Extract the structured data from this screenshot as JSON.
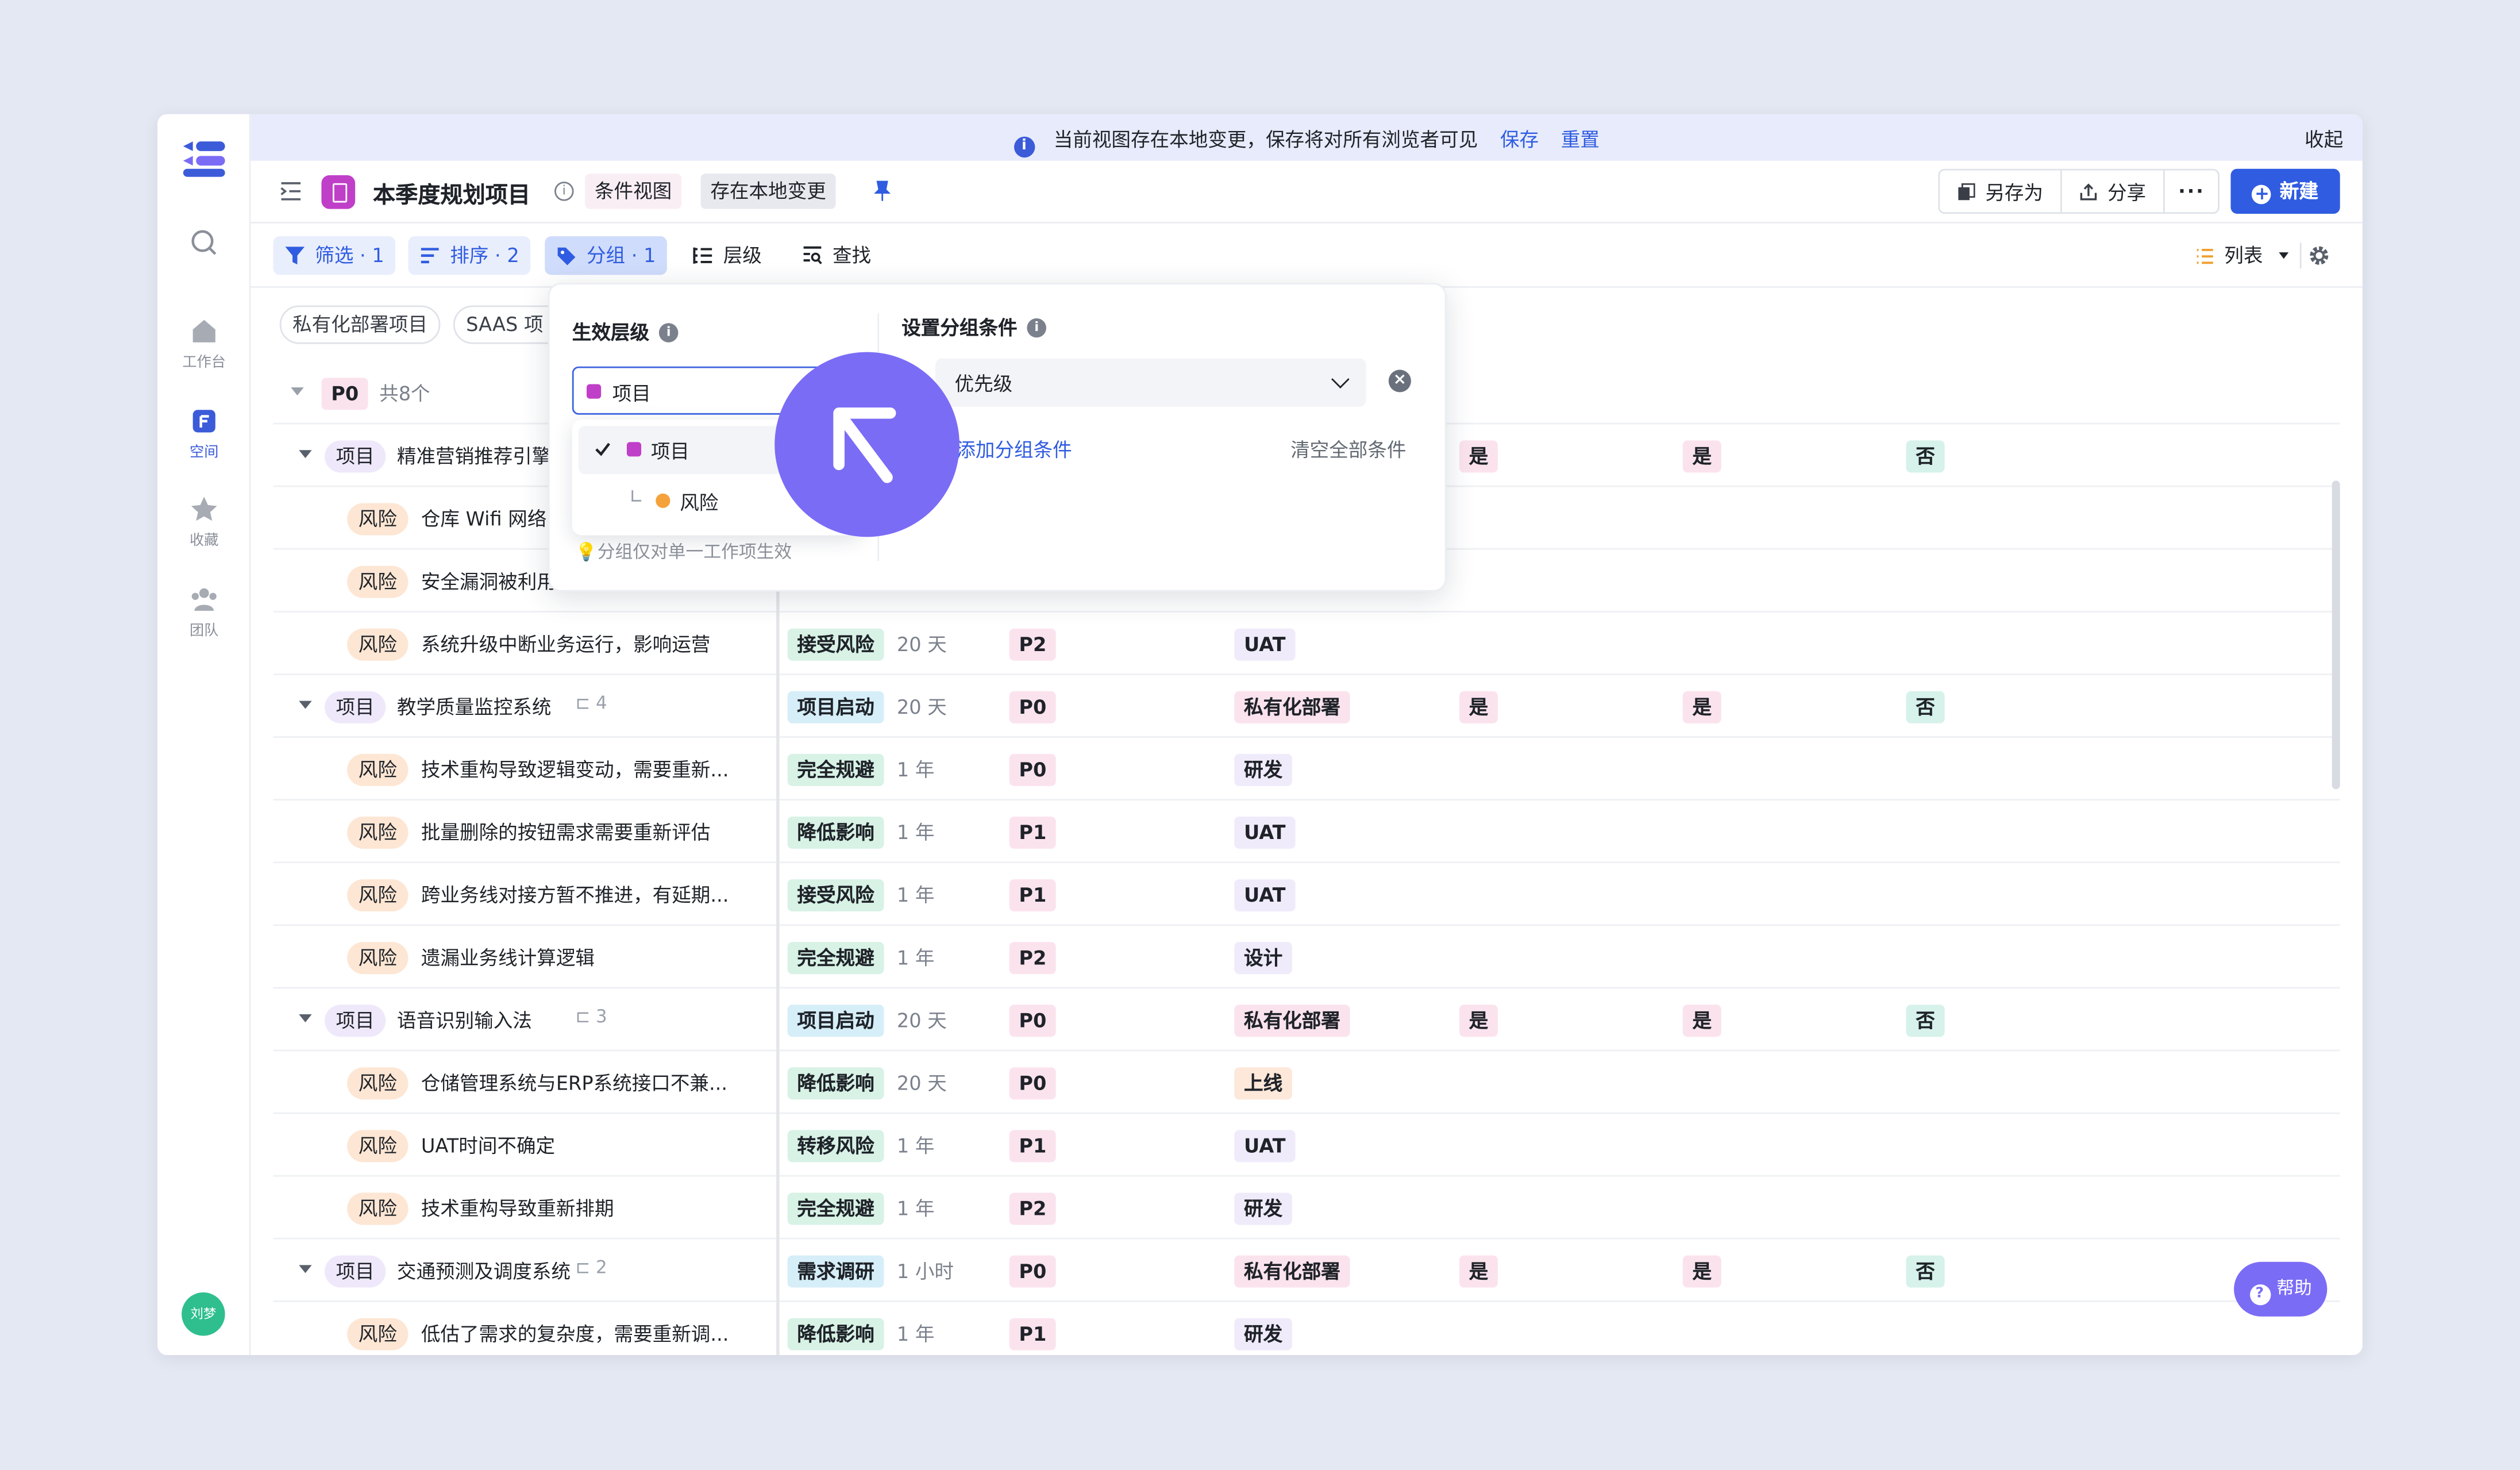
{
  "rail": {
    "items": [
      {
        "label": ""
      },
      {
        "label": "工作台"
      },
      {
        "label": "空间"
      },
      {
        "label": "收藏"
      },
      {
        "label": "团队"
      }
    ],
    "avatar": "刘梦"
  },
  "banner": {
    "message": "当前视图存在本地变更，保存将对所有浏览者可见",
    "save": "保存",
    "reset": "重置",
    "collapse": "收起"
  },
  "header": {
    "title": "本季度规划项目",
    "view_chip": "条件视图",
    "local_chip": "存在本地变更",
    "save_as": "另存为",
    "share": "分享",
    "more": "···",
    "new": "新建"
  },
  "toolbar": {
    "filter": "筛选 · 1",
    "sort": "排序 · 2",
    "group": "分组 · 1",
    "level": "层级",
    "find": "查找",
    "view_mode": "列表"
  },
  "pills": [
    "私有化部署项目",
    "SAAS 项"
  ],
  "group_header": {
    "label": "P0",
    "count": "共8个"
  },
  "rows": [
    {
      "kind": "proj",
      "type": "项目",
      "title": "精准营销推荐引擎",
      "yes1": "是",
      "yes2": "是",
      "no": "否"
    },
    {
      "kind": "risk",
      "type": "风险",
      "title": "仓库 Wifi 网络..."
    },
    {
      "kind": "risk",
      "type": "风险",
      "title": "安全漏洞被利用，..."
    },
    {
      "kind": "risk",
      "type": "风险",
      "title": "系统升级中断业务运行，影响运营",
      "strategy": "接受风险",
      "duration": "20 天",
      "priority": "P2",
      "stage": "UAT"
    },
    {
      "kind": "proj",
      "type": "项目",
      "title": "教学质量监控系统",
      "children": "4",
      "strategy": "项目启动",
      "duration": "20 天",
      "priority": "P0",
      "stage": "私有化部署",
      "yes1": "是",
      "yes2": "是",
      "no": "否"
    },
    {
      "kind": "risk",
      "type": "风险",
      "title": "技术重构导致逻辑变动，需要重新...",
      "strategy": "完全规避",
      "duration": "1 年",
      "priority": "P0",
      "stage": "研发"
    },
    {
      "kind": "risk",
      "type": "风险",
      "title": "批量删除的按钮需求需要重新评估",
      "strategy": "降低影响",
      "duration": "1 年",
      "priority": "P1",
      "stage": "UAT"
    },
    {
      "kind": "risk",
      "type": "风险",
      "title": "跨业务线对接方暂不推进，有延期...",
      "strategy": "接受风险",
      "duration": "1 年",
      "priority": "P1",
      "stage": "UAT"
    },
    {
      "kind": "risk",
      "type": "风险",
      "title": "遗漏业务线计算逻辑",
      "strategy": "完全规避",
      "duration": "1 年",
      "priority": "P2",
      "stage": "设计"
    },
    {
      "kind": "proj",
      "type": "项目",
      "title": "语音识别输入法",
      "children": "3",
      "strategy": "项目启动",
      "duration": "20 天",
      "priority": "P0",
      "stage": "私有化部署",
      "yes1": "是",
      "yes2": "是",
      "no": "否"
    },
    {
      "kind": "risk",
      "type": "风险",
      "title": "仓储管理系统与ERP系统接口不兼...",
      "strategy": "降低影响",
      "duration": "20 天",
      "priority": "P0",
      "stage": "上线"
    },
    {
      "kind": "risk",
      "type": "风险",
      "title": "UAT时间不确定",
      "strategy": "转移风险",
      "duration": "1 年",
      "priority": "P1",
      "stage": "UAT"
    },
    {
      "kind": "risk",
      "type": "风险",
      "title": "技术重构导致重新排期",
      "strategy": "完全规避",
      "duration": "1 年",
      "priority": "P2",
      "stage": "研发"
    },
    {
      "kind": "proj",
      "type": "项目",
      "title": "交通预测及调度系统",
      "children": "2",
      "strategy": "需求调研",
      "duration": "1 小时",
      "priority": "P0",
      "stage": "私有化部署",
      "yes1": "是",
      "yes2": "是",
      "no": "否"
    },
    {
      "kind": "risk",
      "type": "风险",
      "title": "低估了需求的复杂度，需要重新调...",
      "strategy": "降低影响",
      "duration": "1 年",
      "priority": "P1",
      "stage": "研发"
    }
  ],
  "popover": {
    "level_label": "生效层级",
    "selected_level": "项目",
    "options": [
      "项目",
      "风险"
    ],
    "hint": "💡分组仅对单一工作项生效",
    "condition_label": "设置分组条件",
    "condition_value": "优先级",
    "add_condition": "添加分组条件",
    "clear_all": "清空全部条件"
  },
  "help": "帮助",
  "colors": {
    "accent": "#2f5ce0",
    "cursor": "#7b6cf6",
    "project_icon": "#c03fc8",
    "risk_dot": "#f5a23c"
  }
}
